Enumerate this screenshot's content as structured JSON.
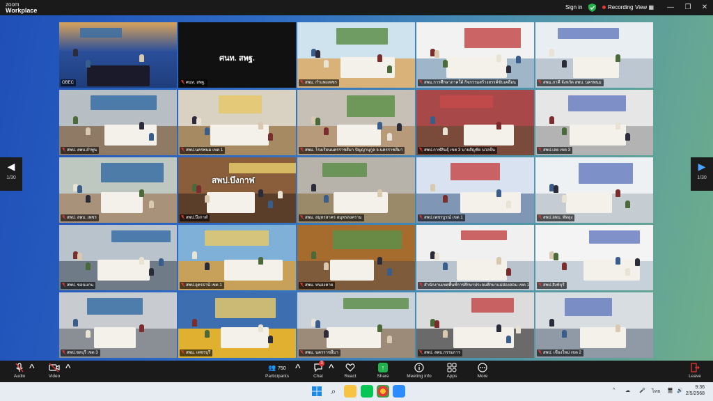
{
  "window": {
    "brand_top": "zoom",
    "brand_bottom": "Workplace",
    "sign_in": "Sign in",
    "recording": "Recording",
    "view": "View"
  },
  "pagination": {
    "prev_label": "1/30",
    "next_label": "1/30"
  },
  "tiles": [
    {
      "name": "OBEC",
      "active": true
    },
    {
      "name": "ศนท. สพฐ.",
      "plate": "ศนท. สพฐ."
    },
    {
      "name": "สพม. กำแพงเพชร"
    },
    {
      "name": "สพม.การศึกษาภาคใต้ กิจกรรมสร้างสรรค์ขับเคลื่อน"
    },
    {
      "name": "สพม.ภาคี จังหวัด ลพบ. นครพนม"
    },
    {
      "name": "สพป. ลพบ.ลำพูน"
    },
    {
      "name": "สพป.นครพนม เขต 1"
    },
    {
      "name": "สพม. โรงเรียนนครราชสีมา ปัญญานุกูล จ.นครราชสีมา"
    },
    {
      "name": "สพป.กาฬสินธุ์ เขต 3 นายสัญชัย นวลจีน"
    },
    {
      "name": "สพป.เลย เขต 3"
    },
    {
      "name": "สพป. ลพบ. เพชร"
    },
    {
      "name": "สพป.บึงกาฬ",
      "sign": "สพป.บึงกาฬ"
    },
    {
      "name": "สพม. สมุทรสาคร สมุทรสงคราม"
    },
    {
      "name": "สพป.เพชรบูรณ์ เขต 1"
    },
    {
      "name": "สพป.ลพบ. พัทลุง"
    },
    {
      "name": "สพป. ขอนแกน"
    },
    {
      "name": "สพป.อุดรธานี เขต 1"
    },
    {
      "name": "สพม. หนองคาย"
    },
    {
      "name": "สำนักงานเขตพื้นที่การศึกษาประถมศึกษาแม่ฮ่องสอน เขต 1"
    },
    {
      "name": "สพป.สิงห์บุรี"
    },
    {
      "name": "สพป.ชลบุรี เขต 3"
    },
    {
      "name": "สพม. เพชรบุรี"
    },
    {
      "name": "สพม. นครราชสีมา"
    },
    {
      "name": "สพป. ลพบ.กรรมการ"
    },
    {
      "name": "สพป. เชียงใหม่ เขต 2"
    }
  ],
  "toolbar": {
    "audio": "Audio",
    "video": "Video",
    "participants": "Participants",
    "participants_count": "750",
    "chat": "Chat",
    "chat_badge": "3",
    "react": "React",
    "share": "Share",
    "meeting_info": "Meeting info",
    "apps": "Apps",
    "more": "More",
    "leave": "Leave"
  },
  "taskbar": {
    "lang": "ไทย",
    "time": "9:36",
    "date": "2/5/2568"
  },
  "colors": {
    "accent_green": "#6fd86b",
    "recording_red": "#e53935",
    "share_green": "#22b14c"
  }
}
